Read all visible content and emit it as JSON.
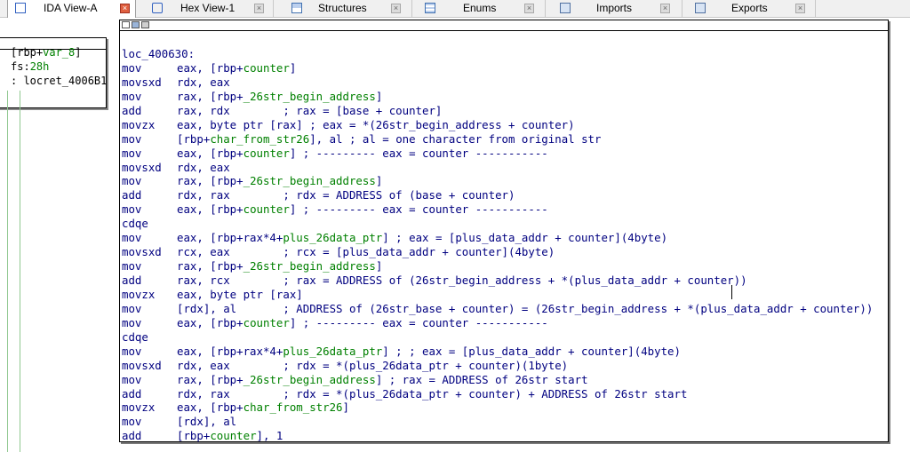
{
  "tabs": [
    {
      "label": "IDA View-A",
      "icon": "ida-view-icon",
      "active": true
    },
    {
      "label": "Hex View-1",
      "icon": "hex-view-icon",
      "active": false
    },
    {
      "label": "Structures",
      "icon": "structures-icon",
      "active": false
    },
    {
      "label": "Enums",
      "icon": "enums-icon",
      "active": false
    },
    {
      "label": "Imports",
      "icon": "imports-icon",
      "active": false
    },
    {
      "label": "Exports",
      "icon": "exports-icon",
      "active": false
    }
  ],
  "left_node": {
    "lines": [
      "[rbp+var_8]",
      "fs:28h",
      ": locret_4006B1"
    ]
  },
  "main_node": {
    "label": "loc_400630:",
    "instructions": [
      {
        "mn": "mov",
        "ops": "eax, [rbp+counter]"
      },
      {
        "mn": "movsxd",
        "ops": "rdx, eax"
      },
      {
        "mn": "mov",
        "ops": "rax, [rbp+_26str_begin_address]"
      },
      {
        "mn": "add",
        "ops": "rax, rdx        ; rax = [base + counter]"
      },
      {
        "mn": "movzx",
        "ops": "eax, byte ptr [rax] ; eax = *(26str_begin_address + counter)"
      },
      {
        "mn": "mov",
        "ops": "[rbp+char_from_str26], al ; al = one character from original str"
      },
      {
        "mn": "mov",
        "ops": "eax, [rbp+counter] ; --------- eax = counter -----------"
      },
      {
        "mn": "movsxd",
        "ops": "rdx, eax"
      },
      {
        "mn": "mov",
        "ops": "rax, [rbp+_26str_begin_address]"
      },
      {
        "mn": "add",
        "ops": "rdx, rax        ; rdx = ADDRESS of (base + counter)"
      },
      {
        "mn": "mov",
        "ops": "eax, [rbp+counter] ; --------- eax = counter -----------"
      },
      {
        "mn": "cdqe",
        "ops": ""
      },
      {
        "mn": "mov",
        "ops": "eax, [rbp+rax*4+plus_26data_ptr] ; eax = [plus_data_addr + counter](4byte)"
      },
      {
        "mn": "movsxd",
        "ops": "rcx, eax        ; rcx = [plus_data_addr + counter](4byte)"
      },
      {
        "mn": "mov",
        "ops": "rax, [rbp+_26str_begin_address]"
      },
      {
        "mn": "add",
        "ops": "rax, rcx        ; rax = ADDRESS of (26str_begin_address + *(plus_data_addr + counter))"
      },
      {
        "mn": "movzx",
        "ops": "eax, byte ptr [rax]"
      },
      {
        "mn": "mov",
        "ops": "[rdx], al       ; ADDRESS of (26str_base + counter) = (26str_begin_address + *(plus_data_addr + counter))"
      },
      {
        "mn": "mov",
        "ops": "eax, [rbp+counter] ; --------- eax = counter -----------"
      },
      {
        "mn": "cdqe",
        "ops": ""
      },
      {
        "mn": "mov",
        "ops": "eax, [rbp+rax*4+plus_26data_ptr] ; ; eax = [plus_data_addr + counter](4byte)"
      },
      {
        "mn": "movsxd",
        "ops": "rdx, eax        ; rdx = *(plus_26data_ptr + counter)(1byte)"
      },
      {
        "mn": "mov",
        "ops": "rax, [rbp+_26str_begin_address] ; rax = ADDRESS of 26str start"
      },
      {
        "mn": "add",
        "ops": "rdx, rax        ; rdx = *(plus_26data_ptr + counter) + ADDRESS of 26str start"
      },
      {
        "mn": "movzx",
        "ops": "eax, [rbp+char_from_str26]"
      },
      {
        "mn": "mov",
        "ops": "[rdx], al"
      },
      {
        "mn": "add",
        "ops": "[rbp+counter], 1"
      }
    ]
  },
  "colors": {
    "code": "#000080",
    "stack_var": "#008000",
    "tab_close_active": "#e06040",
    "flow_line": "#90c890"
  }
}
